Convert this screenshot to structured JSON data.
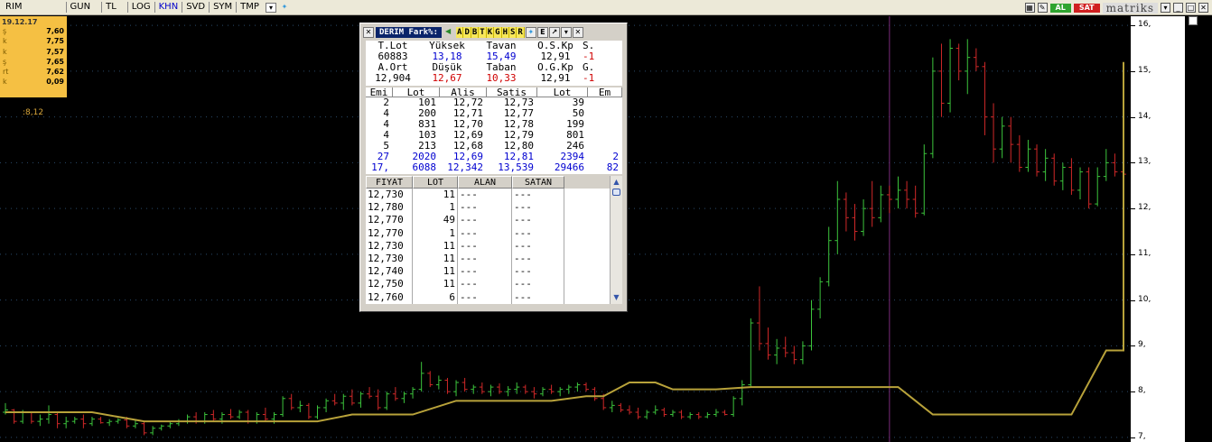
{
  "toolbar": {
    "items": [
      {
        "label": "RIM",
        "active": false
      },
      {
        "label": "GUN",
        "active": false
      },
      {
        "label": "TL",
        "active": false
      },
      {
        "label": "LOG",
        "active": false
      },
      {
        "label": "KHN",
        "active": true
      },
      {
        "label": "SVD",
        "active": false
      },
      {
        "label": "SYM",
        "active": false
      },
      {
        "label": "TMP",
        "active": false
      }
    ],
    "buy_label": "AL",
    "sell_label": "SAT",
    "logo_text": "matriks",
    "colors": {
      "buy": "#2fa42f",
      "sell": "#d02020"
    }
  },
  "info_box": {
    "date": "19.12.17",
    "rows": [
      {
        "key": "ş",
        "value": "7,60"
      },
      {
        "key": "k",
        "value": "7,75"
      },
      {
        "key": "k",
        "value": "7,57"
      },
      {
        "key": "ş",
        "value": "7,65"
      },
      {
        "key": "rt",
        "value": "7,62"
      },
      {
        "key": "k",
        "value": "0,09"
      }
    ]
  },
  "cursor_readout": ":8,12",
  "panel": {
    "title": "DERIM Fark%:",
    "letters": [
      "A",
      "D",
      "B",
      "T",
      "K",
      "G",
      "H",
      "S",
      "R"
    ],
    "summary": [
      [
        "T.Lot",
        "Yüksek",
        "Tavan",
        "O.S.Kp",
        "S."
      ],
      [
        "60883",
        "13,18",
        "15,49",
        "12,91",
        "-1"
      ],
      [
        "A.Ort",
        "Düşük",
        "Taban",
        "O.G.Kp",
        "G."
      ],
      [
        "12,904",
        "12,67",
        "10,33",
        "12,91",
        "-1"
      ]
    ],
    "depth_headers": [
      "Emi",
      "Lot",
      "Alis",
      "Satis",
      "Lot",
      "Em"
    ],
    "depth_rows": [
      [
        "2",
        "101",
        "12,72",
        "12,73",
        "39",
        ""
      ],
      [
        "4",
        "200",
        "12,71",
        "12,77",
        "50",
        ""
      ],
      [
        "4",
        "831",
        "12,70",
        "12,78",
        "199",
        ""
      ],
      [
        "4",
        "103",
        "12,69",
        "12,79",
        "801",
        ""
      ],
      [
        "5",
        "213",
        "12,68",
        "12,80",
        "246",
        ""
      ]
    ],
    "depth_totals": [
      [
        "27",
        "2020",
        "12,69",
        "12,81",
        "2394",
        "2"
      ],
      [
        "17,",
        "6088",
        "12,342",
        "13,539",
        "29466",
        "82"
      ]
    ],
    "trade_headers": [
      "FIYAT",
      "LOT",
      "ALAN",
      "SATAN"
    ],
    "trades": [
      [
        "12,730",
        "11",
        "---",
        "---"
      ],
      [
        "12,780",
        "1",
        "---",
        "---"
      ],
      [
        "12,770",
        "49",
        "---",
        "---"
      ],
      [
        "12,770",
        "1",
        "---",
        "---"
      ],
      [
        "12,730",
        "11",
        "---",
        "---"
      ],
      [
        "12,730",
        "11",
        "---",
        "---"
      ],
      [
        "12,740",
        "11",
        "---",
        "---"
      ],
      [
        "12,750",
        "11",
        "---",
        "---"
      ],
      [
        "12,760",
        "6",
        "---",
        "---"
      ]
    ]
  },
  "chart_data": {
    "type": "line",
    "y_ticks": [
      "16,",
      "15,",
      "14,",
      "13,",
      "12,",
      "11,",
      "10,",
      "9,",
      "8,",
      "7,"
    ],
    "ylim": [
      6.9,
      16.2
    ],
    "colors": {
      "up": "#3cc43c",
      "down": "#d02828",
      "overlay": "#b8a23a",
      "cursor": "#7a2a7a",
      "grid": "#2a4a6a"
    },
    "bars": [
      [
        7.55,
        7.75,
        7.5,
        7.6
      ],
      [
        7.6,
        7.62,
        7.3,
        7.35
      ],
      [
        7.35,
        7.6,
        7.3,
        7.55
      ],
      [
        7.55,
        7.55,
        7.3,
        7.35
      ],
      [
        7.35,
        7.5,
        7.25,
        7.4
      ],
      [
        7.4,
        7.7,
        7.3,
        7.5
      ],
      [
        7.5,
        7.55,
        7.2,
        7.3
      ],
      [
        7.3,
        7.45,
        7.2,
        7.35
      ],
      [
        7.35,
        7.45,
        7.3,
        7.4
      ],
      [
        7.4,
        7.5,
        7.2,
        7.3
      ],
      [
        7.3,
        7.45,
        7.25,
        7.4
      ],
      [
        7.4,
        7.45,
        7.3,
        7.32
      ],
      [
        7.32,
        7.4,
        7.25,
        7.35
      ],
      [
        7.35,
        7.42,
        7.3,
        7.38
      ],
      [
        7.38,
        7.45,
        7.2,
        7.25
      ],
      [
        7.25,
        7.4,
        7.2,
        7.3
      ],
      [
        7.3,
        7.35,
        7.05,
        7.1
      ],
      [
        7.1,
        7.25,
        7.05,
        7.2
      ],
      [
        7.2,
        7.28,
        7.15,
        7.25
      ],
      [
        7.25,
        7.35,
        7.2,
        7.3
      ],
      [
        7.3,
        7.4,
        7.25,
        7.35
      ],
      [
        7.35,
        7.5,
        7.3,
        7.45
      ],
      [
        7.45,
        7.55,
        7.3,
        7.35
      ],
      [
        7.35,
        7.55,
        7.3,
        7.5
      ],
      [
        7.5,
        7.6,
        7.35,
        7.4
      ],
      [
        7.4,
        7.55,
        7.3,
        7.5
      ],
      [
        7.5,
        7.62,
        7.4,
        7.45
      ],
      [
        7.45,
        7.6,
        7.4,
        7.55
      ],
      [
        7.55,
        7.6,
        7.3,
        7.35
      ],
      [
        7.35,
        7.55,
        7.3,
        7.5
      ],
      [
        7.5,
        7.65,
        7.35,
        7.4
      ],
      [
        7.4,
        7.55,
        7.3,
        7.5
      ],
      [
        7.5,
        7.9,
        7.45,
        7.85
      ],
      [
        7.85,
        7.95,
        7.6,
        7.65
      ],
      [
        7.65,
        7.8,
        7.55,
        7.7
      ],
      [
        7.7,
        7.75,
        7.4,
        7.45
      ],
      [
        7.45,
        7.7,
        7.4,
        7.65
      ],
      [
        7.65,
        7.85,
        7.55,
        7.8
      ],
      [
        7.8,
        7.95,
        7.7,
        7.75
      ],
      [
        7.75,
        7.95,
        7.6,
        7.9
      ],
      [
        7.9,
        8.05,
        7.7,
        7.75
      ],
      [
        7.75,
        8.0,
        7.65,
        7.95
      ],
      [
        7.95,
        8.1,
        7.85,
        7.9
      ],
      [
        7.9,
        8.05,
        7.6,
        7.65
      ],
      [
        7.65,
        8.0,
        7.6,
        7.95
      ],
      [
        7.95,
        8.1,
        7.8,
        7.85
      ],
      [
        7.85,
        8.0,
        7.75,
        7.95
      ],
      [
        7.95,
        8.1,
        7.85,
        8.05
      ],
      [
        8.05,
        8.65,
        8.0,
        8.4
      ],
      [
        8.4,
        8.45,
        8.1,
        8.15
      ],
      [
        8.15,
        8.35,
        8.05,
        8.25
      ],
      [
        8.25,
        8.3,
        7.95,
        8.0
      ],
      [
        8.0,
        8.25,
        7.9,
        8.2
      ],
      [
        8.2,
        8.3,
        8.0,
        8.05
      ],
      [
        8.05,
        8.15,
        7.95,
        8.1
      ],
      [
        8.1,
        8.2,
        7.95,
        8.0
      ],
      [
        8.0,
        8.15,
        7.9,
        8.1
      ],
      [
        8.1,
        8.18,
        7.95,
        8.0
      ],
      [
        8.0,
        8.12,
        7.9,
        8.05
      ],
      [
        8.05,
        8.2,
        7.95,
        8.1
      ],
      [
        8.1,
        8.15,
        7.95,
        8.0
      ],
      [
        8.0,
        8.1,
        7.85,
        7.95
      ],
      [
        7.95,
        8.1,
        7.9,
        8.05
      ],
      [
        8.05,
        8.15,
        7.95,
        8.0
      ],
      [
        8.0,
        8.1,
        7.9,
        8.05
      ],
      [
        8.05,
        8.15,
        7.95,
        8.1
      ],
      [
        8.1,
        8.2,
        8.0,
        8.15
      ],
      [
        8.15,
        8.2,
        8.0,
        8.05
      ],
      [
        8.05,
        8.1,
        7.8,
        7.85
      ],
      [
        7.85,
        7.95,
        7.6,
        7.65
      ],
      [
        7.65,
        7.8,
        7.55,
        7.7
      ],
      [
        7.7,
        7.75,
        7.55,
        7.6
      ],
      [
        7.6,
        7.7,
        7.5,
        7.55
      ],
      [
        7.55,
        7.65,
        7.4,
        7.45
      ],
      [
        7.45,
        7.6,
        7.4,
        7.55
      ],
      [
        7.55,
        7.7,
        7.5,
        7.6
      ],
      [
        7.6,
        7.65,
        7.45,
        7.5
      ],
      [
        7.5,
        7.6,
        7.45,
        7.55
      ],
      [
        7.55,
        7.6,
        7.4,
        7.45
      ],
      [
        7.45,
        7.55,
        7.4,
        7.5
      ],
      [
        7.5,
        7.55,
        7.4,
        7.45
      ],
      [
        7.45,
        7.55,
        7.42,
        7.5
      ],
      [
        7.5,
        7.62,
        7.45,
        7.55
      ],
      [
        7.55,
        7.6,
        7.48,
        7.5
      ],
      [
        7.5,
        7.9,
        7.45,
        7.85
      ],
      [
        7.85,
        8.25,
        7.7,
        8.15
      ],
      [
        8.15,
        9.6,
        8.1,
        9.5
      ],
      [
        9.5,
        10.3,
        8.9,
        9.05
      ],
      [
        9.05,
        9.4,
        8.7,
        8.8
      ],
      [
        8.8,
        9.15,
        8.6,
        8.95
      ],
      [
        8.95,
        9.2,
        8.75,
        8.85
      ],
      [
        8.85,
        9.0,
        8.6,
        8.7
      ],
      [
        8.7,
        9.1,
        8.6,
        9.0
      ],
      [
        9.0,
        10.0,
        8.9,
        9.8
      ],
      [
        9.8,
        10.5,
        9.6,
        10.4
      ],
      [
        10.4,
        11.6,
        10.3,
        11.3
      ],
      [
        11.3,
        12.6,
        11.0,
        12.2
      ],
      [
        12.2,
        12.35,
        11.5,
        11.8
      ],
      [
        11.8,
        12.1,
        11.3,
        11.5
      ],
      [
        11.5,
        12.2,
        11.4,
        12.0
      ],
      [
        12.0,
        12.6,
        11.6,
        11.8
      ],
      [
        11.8,
        12.5,
        11.7,
        12.3
      ],
      [
        12.3,
        12.5,
        11.9,
        12.2
      ],
      [
        12.2,
        12.7,
        12.0,
        12.4
      ],
      [
        12.4,
        12.6,
        12.0,
        12.2
      ],
      [
        12.2,
        12.5,
        11.8,
        11.9
      ],
      [
        11.9,
        13.4,
        11.85,
        13.2
      ],
      [
        13.2,
        15.3,
        13.1,
        15.0
      ],
      [
        15.0,
        15.6,
        14.0,
        14.3
      ],
      [
        14.3,
        15.7,
        14.1,
        15.5
      ],
      [
        15.5,
        15.6,
        14.8,
        15.0
      ],
      [
        15.0,
        15.7,
        14.5,
        15.3
      ],
      [
        15.3,
        15.5,
        15.0,
        15.1
      ],
      [
        15.1,
        15.2,
        13.6,
        14.0
      ],
      [
        14.0,
        14.3,
        13.0,
        13.3
      ],
      [
        13.3,
        14.0,
        13.1,
        13.8
      ],
      [
        13.8,
        14.0,
        13.0,
        13.4
      ],
      [
        13.4,
        13.6,
        12.8,
        12.9
      ],
      [
        12.9,
        13.5,
        12.8,
        13.3
      ],
      [
        13.3,
        13.4,
        12.7,
        12.8
      ],
      [
        12.8,
        13.3,
        12.6,
        13.1
      ],
      [
        13.1,
        13.2,
        12.5,
        12.6
      ],
      [
        12.6,
        13.0,
        12.4,
        12.9
      ],
      [
        12.9,
        13.1,
        12.3,
        12.4
      ],
      [
        12.4,
        12.9,
        12.2,
        12.8
      ],
      [
        12.8,
        12.9,
        12.0,
        12.1
      ],
      [
        12.1,
        12.9,
        12.05,
        12.7
      ],
      [
        12.7,
        13.3,
        12.6,
        13.0
      ],
      [
        13.0,
        13.2,
        12.7,
        12.8
      ],
      [
        12.8,
        12.85,
        12.7,
        12.75
      ]
    ],
    "overlay": [
      [
        0,
        7.55
      ],
      [
        10,
        7.55
      ],
      [
        16,
        7.35
      ],
      [
        36,
        7.35
      ],
      [
        40,
        7.5
      ],
      [
        47,
        7.5
      ],
      [
        52,
        7.8
      ],
      [
        63,
        7.8
      ],
      [
        67,
        7.9
      ],
      [
        69,
        7.9
      ],
      [
        72,
        8.2
      ],
      [
        75,
        8.2
      ],
      [
        77,
        8.05
      ],
      [
        82,
        8.05
      ],
      [
        86,
        8.1
      ],
      [
        103,
        8.1
      ],
      [
        107,
        7.5
      ],
      [
        123,
        7.5
      ],
      [
        127,
        8.9
      ],
      [
        154,
        8.9
      ],
      [
        158,
        15.2
      ],
      [
        176,
        15.2
      ],
      [
        179,
        12.75
      ],
      [
        185,
        12.75
      ]
    ],
    "cursor_index": 102
  }
}
